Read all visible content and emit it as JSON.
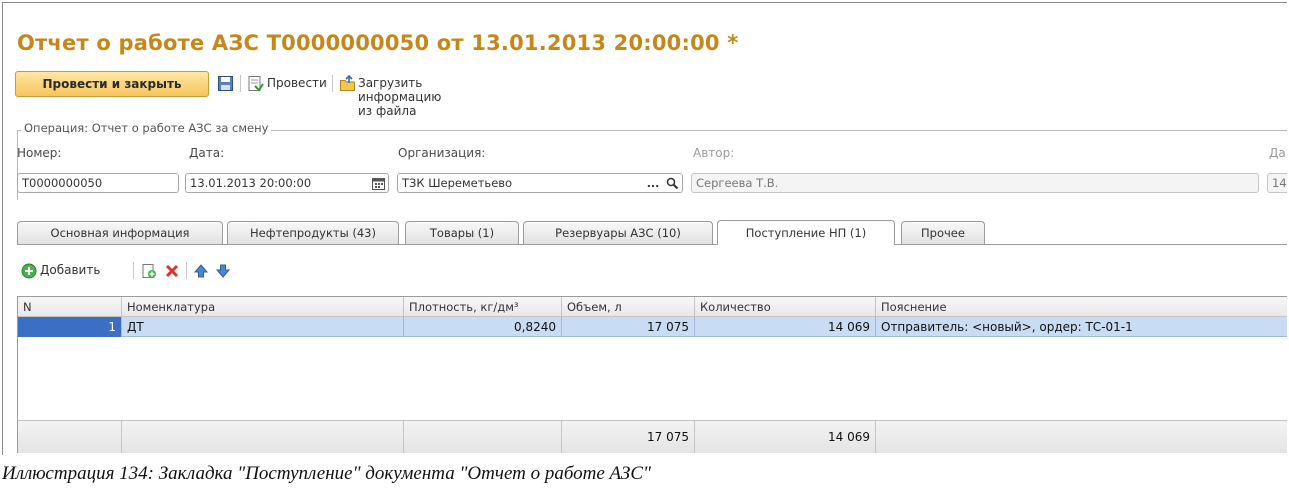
{
  "document": {
    "title": "Отчет о работе АЗС Т0000000050 от 13.01.2013 20:00:00 *"
  },
  "toolbar": {
    "post_close_label": "Провести и закрыть",
    "post_label": "Провести",
    "load_file_label": "Загрузить информацию из файла"
  },
  "operation_group": {
    "title": "Операция: Отчет о работе АЗС за смену"
  },
  "fields": {
    "number_label": "Номер:",
    "number_value": "Т0000000050",
    "date_label": "Дата:",
    "date_value": "13.01.2013 20:00:00",
    "org_label": "Организация:",
    "org_value": "ТЗК Шереметьево",
    "org_button": "...",
    "author_label": "Автор:",
    "author_value": "Сергеева Т.В.",
    "extra_label": "Да",
    "extra_value": "14"
  },
  "tabs": [
    {
      "label": "Основная информация",
      "active": false
    },
    {
      "label": "Нефтепродукты (43)",
      "active": false
    },
    {
      "label": "Товары (1)",
      "active": false
    },
    {
      "label": "Резервуары АЗС (10)",
      "active": false
    },
    {
      "label": "Поступление НП (1)",
      "active": true
    },
    {
      "label": "Прочее",
      "active": false
    }
  ],
  "subtoolbar": {
    "add_label": "Добавить"
  },
  "table": {
    "columns": [
      "N",
      "Номенклатура",
      "Плотность, кг/дм³",
      "Объем, л",
      "Количество",
      "Пояснение"
    ],
    "rows": [
      {
        "n": "1",
        "item": "ДТ",
        "density": "0,8240",
        "volume": "17 075",
        "quantity": "14 069",
        "note": "Отправитель: <новый>, ордер: ТС-01-1"
      }
    ],
    "totals": {
      "volume": "17 075",
      "quantity": "14 069"
    }
  },
  "caption": "Иллюстрация 134: Закладка \"Поступление\" документа \"Отчет о работе АЗС\"",
  "colors": {
    "title": "#c5871a",
    "primary_button": "#f6c55a",
    "selected_row": "#c8dcf3",
    "selected_cell": "#3a6fc4"
  }
}
